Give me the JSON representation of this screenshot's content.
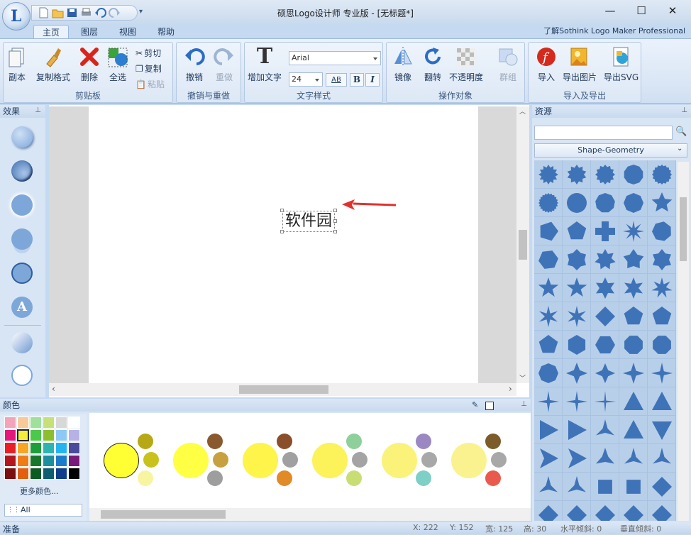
{
  "window": {
    "title": "硕思Logo设计师 专业版 - [无标题*]",
    "minimize": "—",
    "maximize": "☐",
    "close": "✕"
  },
  "tabs": [
    "主页",
    "图层",
    "视图",
    "帮助"
  ],
  "help_link": "了解Sothink Logo Maker Professional",
  "clipboard": {
    "label": "剪贴板",
    "copy_obj": "副本",
    "copy_format": "复制格式",
    "delete": "删除",
    "select_all": "全选",
    "cut": "剪切",
    "copy": "复制",
    "paste": "粘贴"
  },
  "undo_group": {
    "label": "撤销与重做",
    "undo": "撤销",
    "redo": "重做"
  },
  "text_style": {
    "label": "文字样式",
    "add_text": "增加文字",
    "font": "Arial",
    "size": "24",
    "spacing": "AB",
    "bold": "B",
    "italic": "I"
  },
  "operate": {
    "label": "操作对象",
    "mirror": "镜像",
    "flip": "翻转",
    "opacity": "不透明度",
    "group": "群组"
  },
  "import_export": {
    "label": "导入及导出",
    "import": "导入",
    "export_image": "导出图片",
    "export_svg": "导出SVG"
  },
  "effects_panel": {
    "title": "效果"
  },
  "canvas": {
    "text": "软件园"
  },
  "resources": {
    "title": "资源",
    "search_placeholder": "",
    "category": "Shape-Geometry"
  },
  "colors": {
    "title": "颜色",
    "more": "更多颜色...",
    "filter": "All"
  },
  "status": {
    "ready": "准备",
    "x": "X: 222",
    "y": "Y: 152",
    "w": "宽: 125",
    "h": "高: 30",
    "hs": "水平倾斜: 0",
    "vs": "垂直倾斜: 0"
  },
  "accent": "#4a7ebb",
  "shape_color": "#3f73b8"
}
